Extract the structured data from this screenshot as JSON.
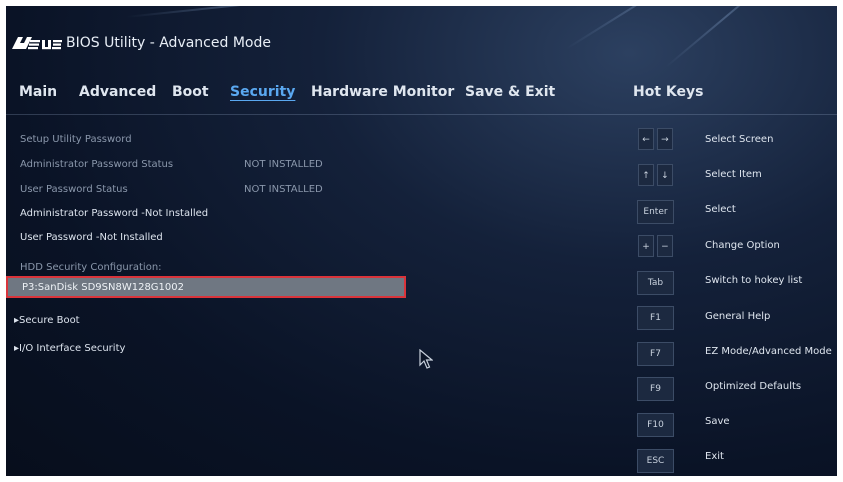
{
  "app": {
    "brand": "ASUS",
    "title": "BIOS Utility - Advanced Mode"
  },
  "nav": {
    "tabs": [
      {
        "label": "Main",
        "active": false
      },
      {
        "label": "Advanced",
        "active": false
      },
      {
        "label": "Boot",
        "active": false
      },
      {
        "label": "Security",
        "active": true
      },
      {
        "label": "Hardware Monitor",
        "active": false
      },
      {
        "label": "Save & Exit",
        "active": false
      }
    ]
  },
  "main": {
    "setup_password_heading": "Setup Utility Password",
    "admin_status_label": "Administrator Password Status",
    "admin_status_value": "NOT INSTALLED",
    "user_status_label": "User Password Status",
    "user_status_value": "NOT INSTALLED",
    "admin_password_item": "Administrator Password -Not Installed",
    "user_password_item": "User Password -Not Installed",
    "hdd_heading": "HDD Security Configuration:",
    "hdd_selected": "P3:SanDisk SD9SN8W128G1002",
    "secure_boot": "Secure Boot",
    "io_security": "I/O Interface Security"
  },
  "hotkeys": {
    "title": "Hot Keys",
    "items": [
      {
        "key": "← →",
        "desc": "Select Screen"
      },
      {
        "key": "↑ ↓",
        "desc": "Select Item"
      },
      {
        "key": "Enter",
        "desc": "Select"
      },
      {
        "key": "+ −",
        "desc": "Change Option"
      },
      {
        "key": "Tab",
        "desc": "Switch to hokey list"
      },
      {
        "key": "F1",
        "desc": "General Help"
      },
      {
        "key": "F7",
        "desc": "EZ Mode/Advanced Mode"
      },
      {
        "key": "F9",
        "desc": "Optimized Defaults"
      },
      {
        "key": "F10",
        "desc": "Save"
      },
      {
        "key": "ESC",
        "desc": "Exit"
      }
    ]
  },
  "colors": {
    "background": "#0a1326",
    "active_tab": "#5aa8f0",
    "selection": "#6f7782",
    "selection_border": "#d9343b"
  }
}
